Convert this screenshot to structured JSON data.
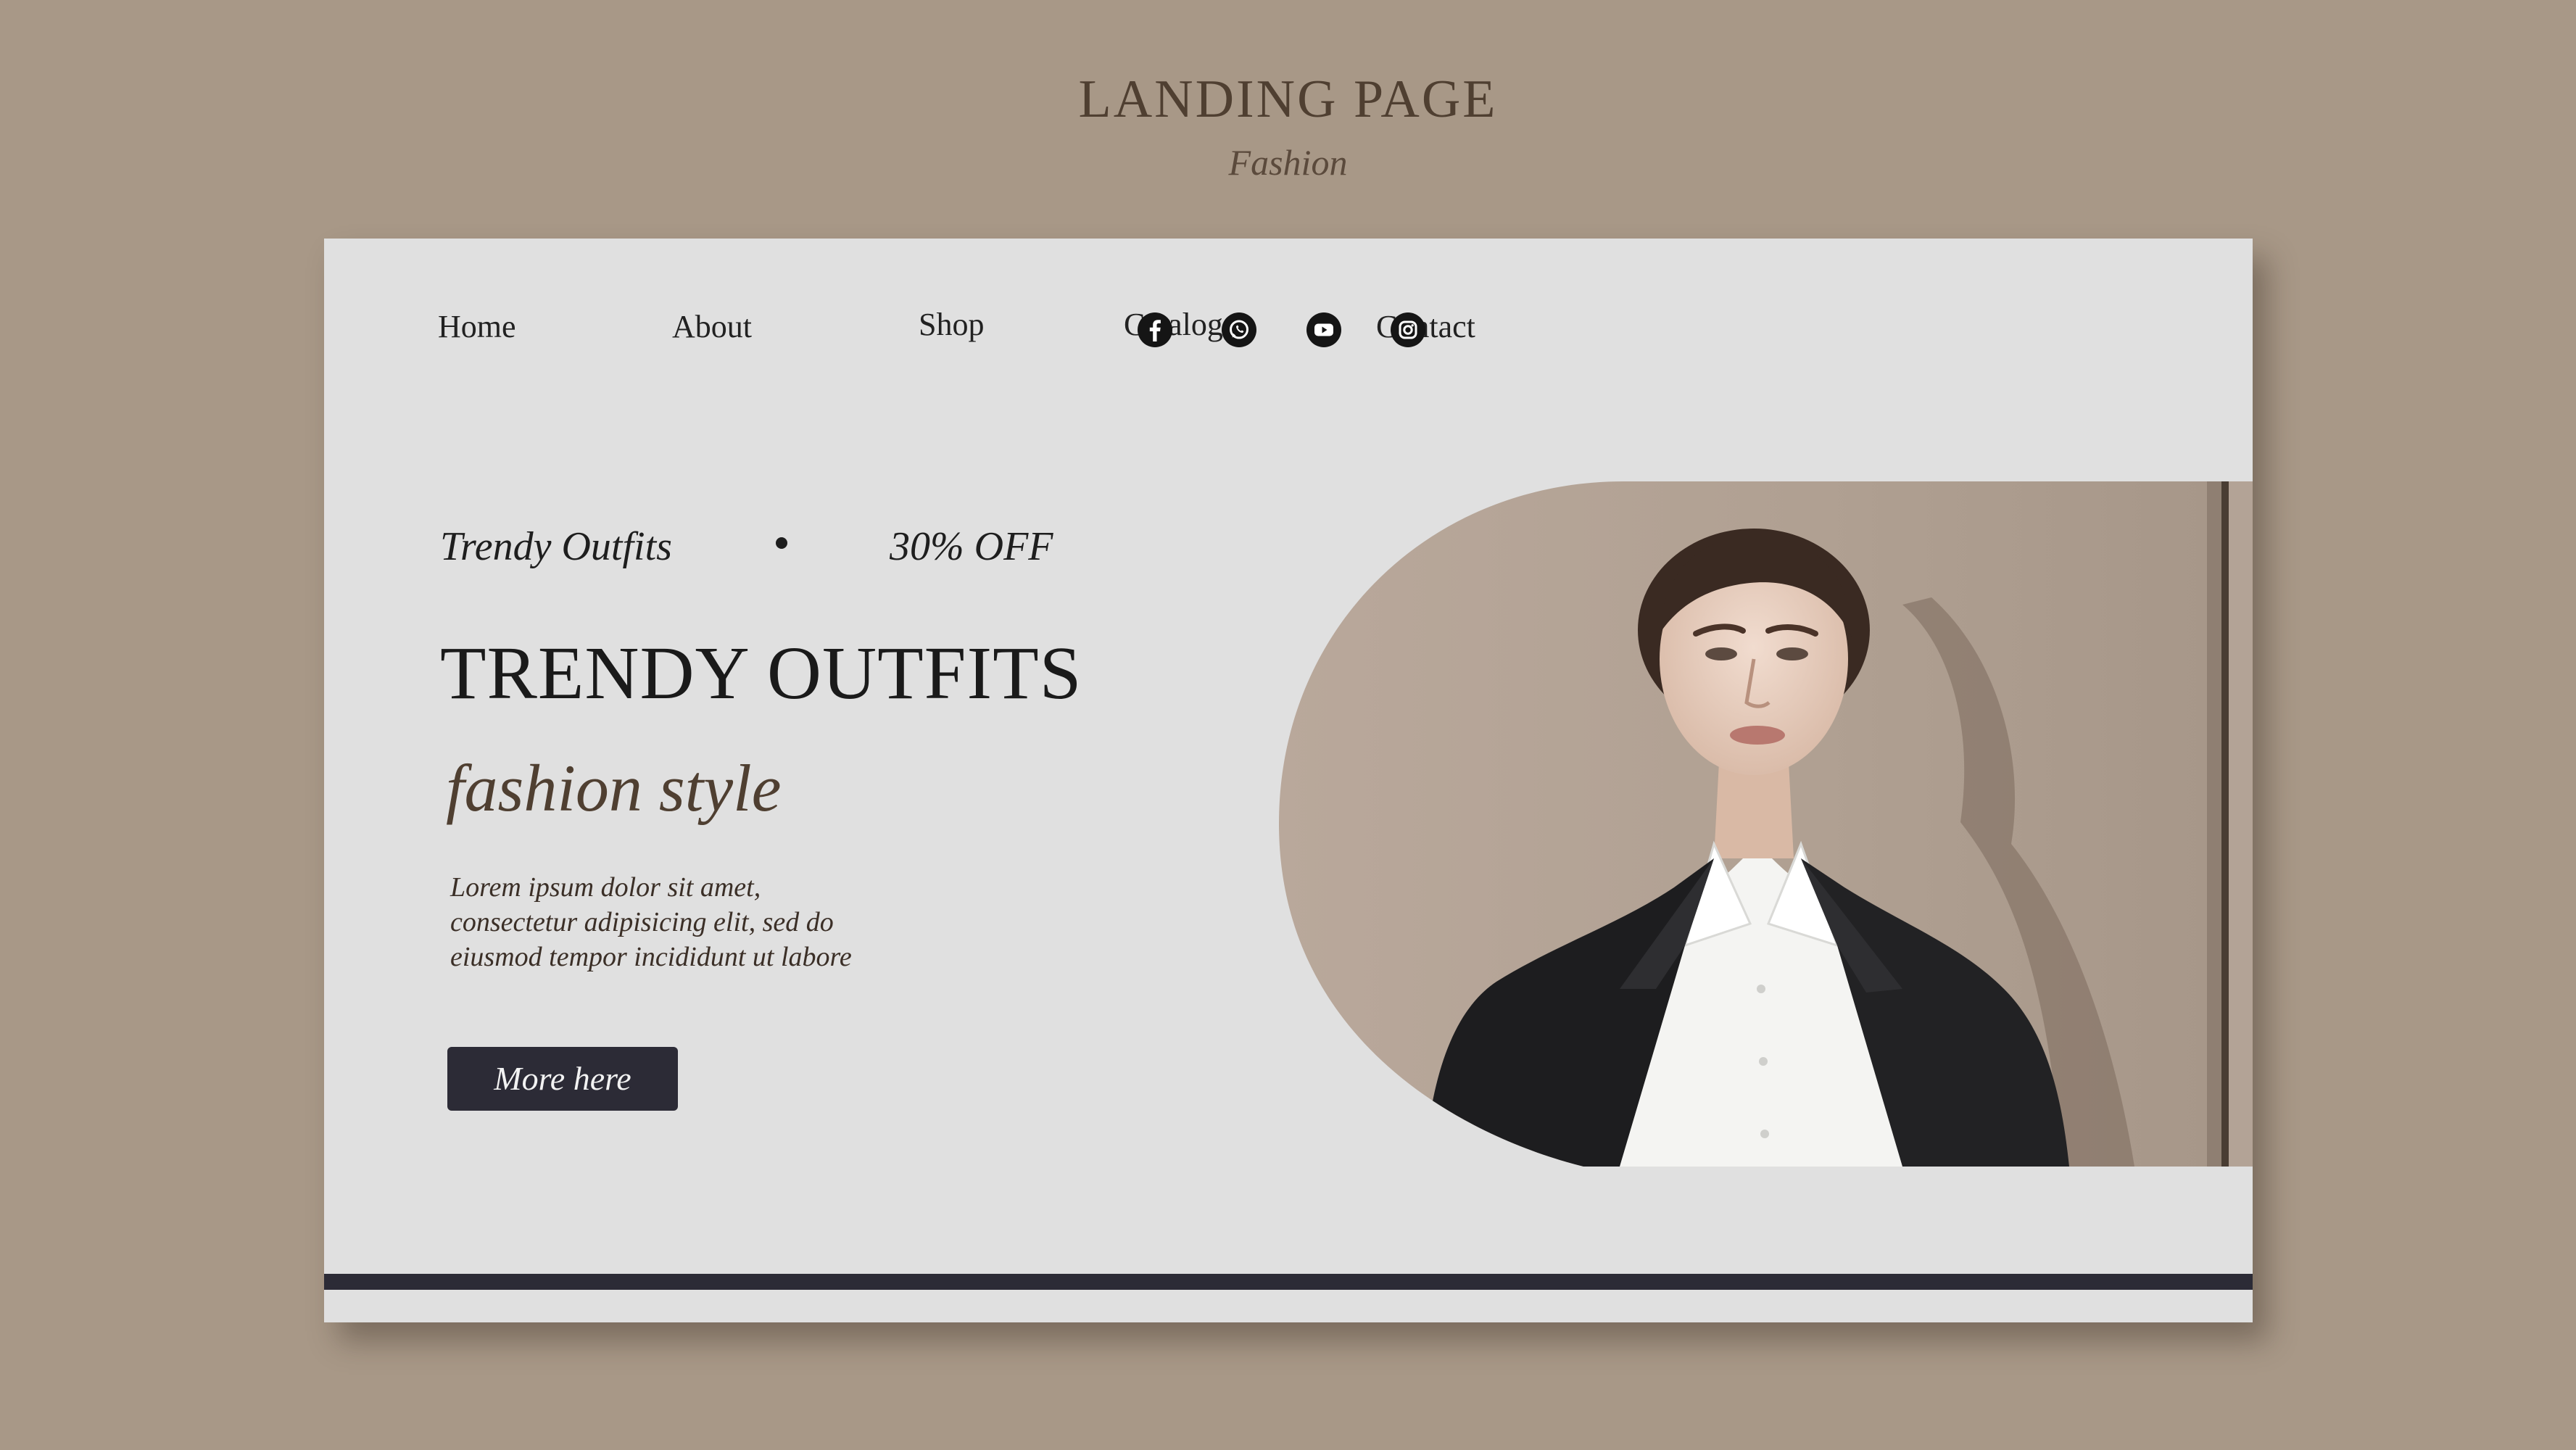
{
  "presentation": {
    "title": "LANDING PAGE",
    "subtitle": "Fashion"
  },
  "nav": {
    "items": [
      {
        "label": "Home"
      },
      {
        "label": "About"
      },
      {
        "label": "Shop"
      },
      {
        "label": "Catalog"
      },
      {
        "label": "Contact"
      }
    ]
  },
  "social": [
    {
      "icon": "facebook-icon"
    },
    {
      "icon": "whatsapp-icon"
    },
    {
      "icon": "youtube-icon"
    },
    {
      "icon": "instagram-icon"
    }
  ],
  "hero": {
    "tag_left": "Trendy Outfits",
    "tag_right": "30% OFF",
    "heading": "TRENDY OUTFITS",
    "subheading": "fashion style",
    "body_lines": [
      "Lorem ipsum dolor sit amet,",
      "consectetur adipisicing elit, sed do",
      "eiusmod tempor incididunt ut labore"
    ],
    "cta_label": "More here"
  },
  "colors": {
    "background": "#a89887",
    "card": "#e0e0e0",
    "accent_dark": "#2c2b36",
    "brown_text": "#4f3f31",
    "photo_wall": "#b8a79a"
  }
}
